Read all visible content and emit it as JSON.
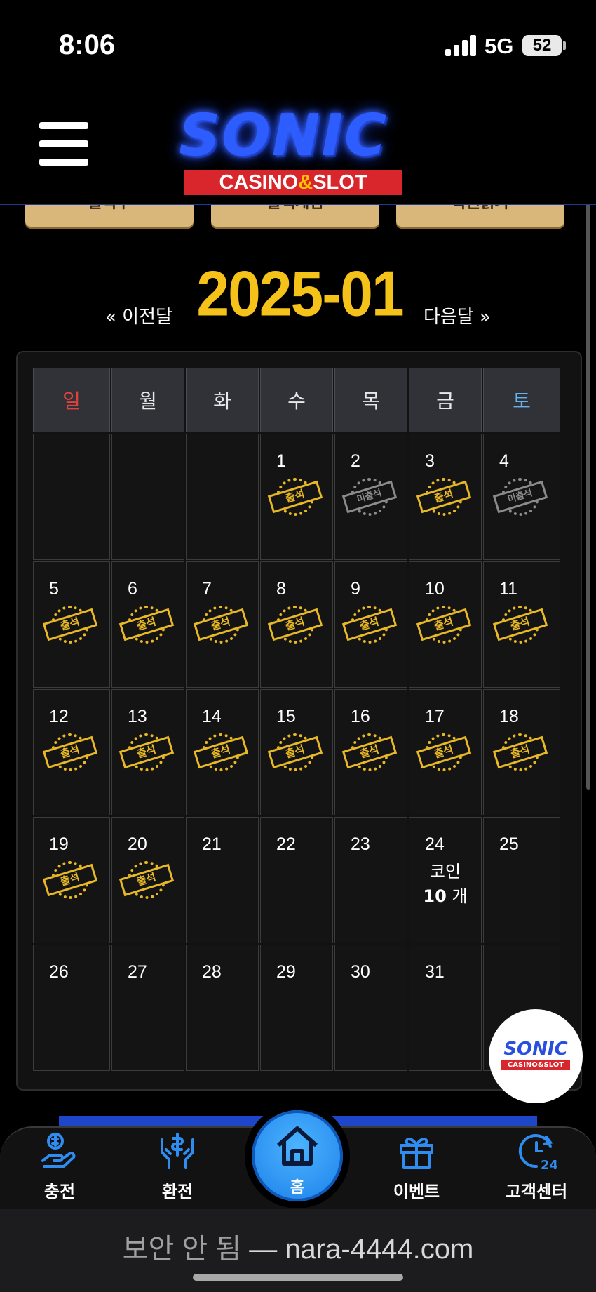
{
  "status": {
    "time": "8:06",
    "network": "5G",
    "battery": "52"
  },
  "header": {
    "logo_main": "SONIC",
    "logo_sub_a": "CASINO",
    "logo_sub_amp": "&",
    "logo_sub_b": "SLOT"
  },
  "top_buttons": [
    "출석부",
    "출첵게임",
    "복권읽기"
  ],
  "calendar": {
    "prev_label": "« 이전달",
    "next_label": "다음달 »",
    "month": "2025-01",
    "weekdays": [
      "일",
      "월",
      "화",
      "수",
      "목",
      "금",
      "토"
    ],
    "attended_label": "출석",
    "absent_label": "미출석",
    "weeks": [
      [
        null,
        null,
        null,
        {
          "day": "1",
          "stamp": "attended"
        },
        {
          "day": "2",
          "stamp": "absent"
        },
        {
          "day": "3",
          "stamp": "attended"
        },
        {
          "day": "4",
          "stamp": "absent"
        }
      ],
      [
        {
          "day": "5",
          "stamp": "attended"
        },
        {
          "day": "6",
          "stamp": "attended"
        },
        {
          "day": "7",
          "stamp": "attended"
        },
        {
          "day": "8",
          "stamp": "attended"
        },
        {
          "day": "9",
          "stamp": "attended"
        },
        {
          "day": "10",
          "stamp": "attended"
        },
        {
          "day": "11",
          "stamp": "attended"
        }
      ],
      [
        {
          "day": "12",
          "stamp": "attended"
        },
        {
          "day": "13",
          "stamp": "attended"
        },
        {
          "day": "14",
          "stamp": "attended"
        },
        {
          "day": "15",
          "stamp": "attended"
        },
        {
          "day": "16",
          "stamp": "attended"
        },
        {
          "day": "17",
          "stamp": "attended"
        },
        {
          "day": "18",
          "stamp": "attended"
        }
      ],
      [
        {
          "day": "19",
          "stamp": "attended"
        },
        {
          "day": "20",
          "stamp": "attended"
        },
        {
          "day": "21"
        },
        {
          "day": "22"
        },
        {
          "day": "23"
        },
        {
          "day": "24",
          "coin_label": "코인",
          "coin_count": "10",
          "coin_unit": "개"
        },
        {
          "day": "25"
        }
      ],
      [
        {
          "day": "26"
        },
        {
          "day": "27"
        },
        {
          "day": "28"
        },
        {
          "day": "29"
        },
        {
          "day": "30"
        },
        {
          "day": "31"
        },
        null
      ]
    ]
  },
  "float_logo": {
    "main": "SONIC",
    "sub": "CASINO&SLOT"
  },
  "bottom_nav": {
    "charge": "충전",
    "exchange": "환전",
    "home": "홈",
    "events": "이벤트",
    "support": "고객센터"
  },
  "browser": {
    "security_warning": "보안 안 됨",
    "separator": " — ",
    "domain": "nara-4444.com"
  },
  "colors": {
    "accent_gold": "#f5c21a",
    "nav_blue": "#2f8cf0",
    "sunday": "#e0433d",
    "saturday": "#64b4f0"
  }
}
